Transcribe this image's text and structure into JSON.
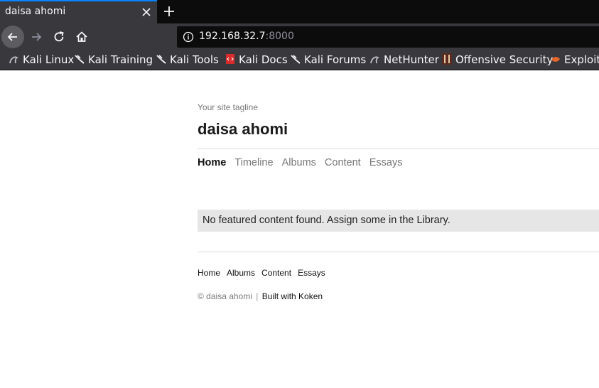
{
  "browser": {
    "tab_title": "daisa ahomi",
    "url_host": "192.168.32.7",
    "url_port": ":8000",
    "bookmarks": [
      {
        "label": "Kali Linux",
        "icon": "kali-dragon-icon"
      },
      {
        "label": "Kali Training",
        "icon": "kali-dragon-icon"
      },
      {
        "label": "Kali Tools",
        "icon": "kali-dragon-icon"
      },
      {
        "label": "Kali Docs",
        "icon": "kali-docs-icon"
      },
      {
        "label": "Kali Forums",
        "icon": "kali-dragon-icon"
      },
      {
        "label": "NetHunter",
        "icon": "nethunter-icon"
      },
      {
        "label": "Offensive Security",
        "icon": "offsec-icon"
      },
      {
        "label": "Exploit-",
        "icon": "exploit-db-icon"
      }
    ]
  },
  "site": {
    "tagline": "Your site tagline",
    "title": "daisa ahomi",
    "nav": [
      "Home",
      "Timeline",
      "Albums",
      "Content",
      "Essays"
    ],
    "notice": "No featured content found. Assign some in the Library.",
    "footer_nav": [
      "Home",
      "Albums",
      "Content",
      "Essays"
    ],
    "copyright": "© daisa ahomi",
    "separator": "|",
    "built_with": "Built with Koken"
  },
  "colors": {
    "chrome_dark": "#0c0c0d",
    "chrome_tab": "#38383d",
    "accent": "#0a84ff",
    "notice_bg": "#e6e6e6"
  }
}
